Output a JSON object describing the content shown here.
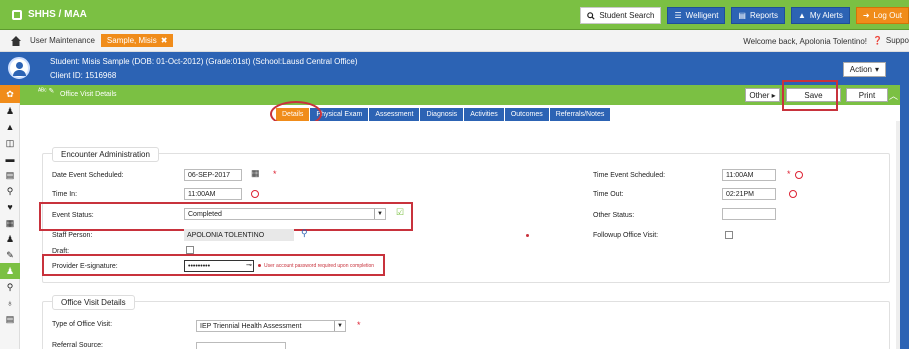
{
  "app": {
    "title": "SHHS / MAA"
  },
  "topbar": {
    "student_search": "Student Search",
    "welligent": "Welligent",
    "reports": "Reports",
    "my_alerts": "My Alerts",
    "log_out": "Log Out"
  },
  "breadcrumb": {
    "section": "User Maintenance",
    "tag": "Sample, Misis",
    "welcome": "Welcome back, Apolonia Tolentino!",
    "support": "Suppo"
  },
  "student": {
    "line1": "Student: Misis Sample (DOB: 01-Oct-2012) (Grade:01st) (School:Lausd Central Office)",
    "client_id": "Client ID: 1516968",
    "action": "Action"
  },
  "section": {
    "title": "Office Visit Details",
    "other": "Other",
    "save": "Save",
    "print": "Print"
  },
  "tabs": [
    {
      "label": "Details",
      "active": true
    },
    {
      "label": "Physical Exam"
    },
    {
      "label": "Assessment"
    },
    {
      "label": "Diagnosis"
    },
    {
      "label": "Activities"
    },
    {
      "label": "Outcomes"
    },
    {
      "label": "Referrals/Notes"
    }
  ],
  "encounter": {
    "legend": "Encounter Administration",
    "date_label": "Date Event Scheduled:",
    "date_value": "06-SEP-2017",
    "time_in_label": "Time In:",
    "time_in_value": "11:00AM",
    "event_status_label": "Event Status:",
    "event_status_value": "Completed",
    "staff_label": "Staff Person:",
    "staff_value": "APOLONIA TOLENTINO",
    "draft_label": "Draft:",
    "esig_label": "Provider E-signature:",
    "esig_value": "•••••••••",
    "esig_hint": "User account password required upon completion",
    "time_sched_label": "Time Event Scheduled:",
    "time_sched_value": "11:00AM",
    "time_out_label": "Time Out:",
    "time_out_value": "02:21PM",
    "other_status_label": "Other Status:",
    "followup_label": "Followup Office Visit:"
  },
  "office_visit": {
    "legend": "Office Visit Details",
    "type_label": "Type of Office Visit:",
    "type_value": "IEP Triennial Health Assessment",
    "referral_label": "Referral Source:"
  },
  "colors": {
    "green": "#7bc043",
    "blue": "#2c63b4",
    "orange": "#f08c1a",
    "annotation_red": "#c8323c"
  }
}
